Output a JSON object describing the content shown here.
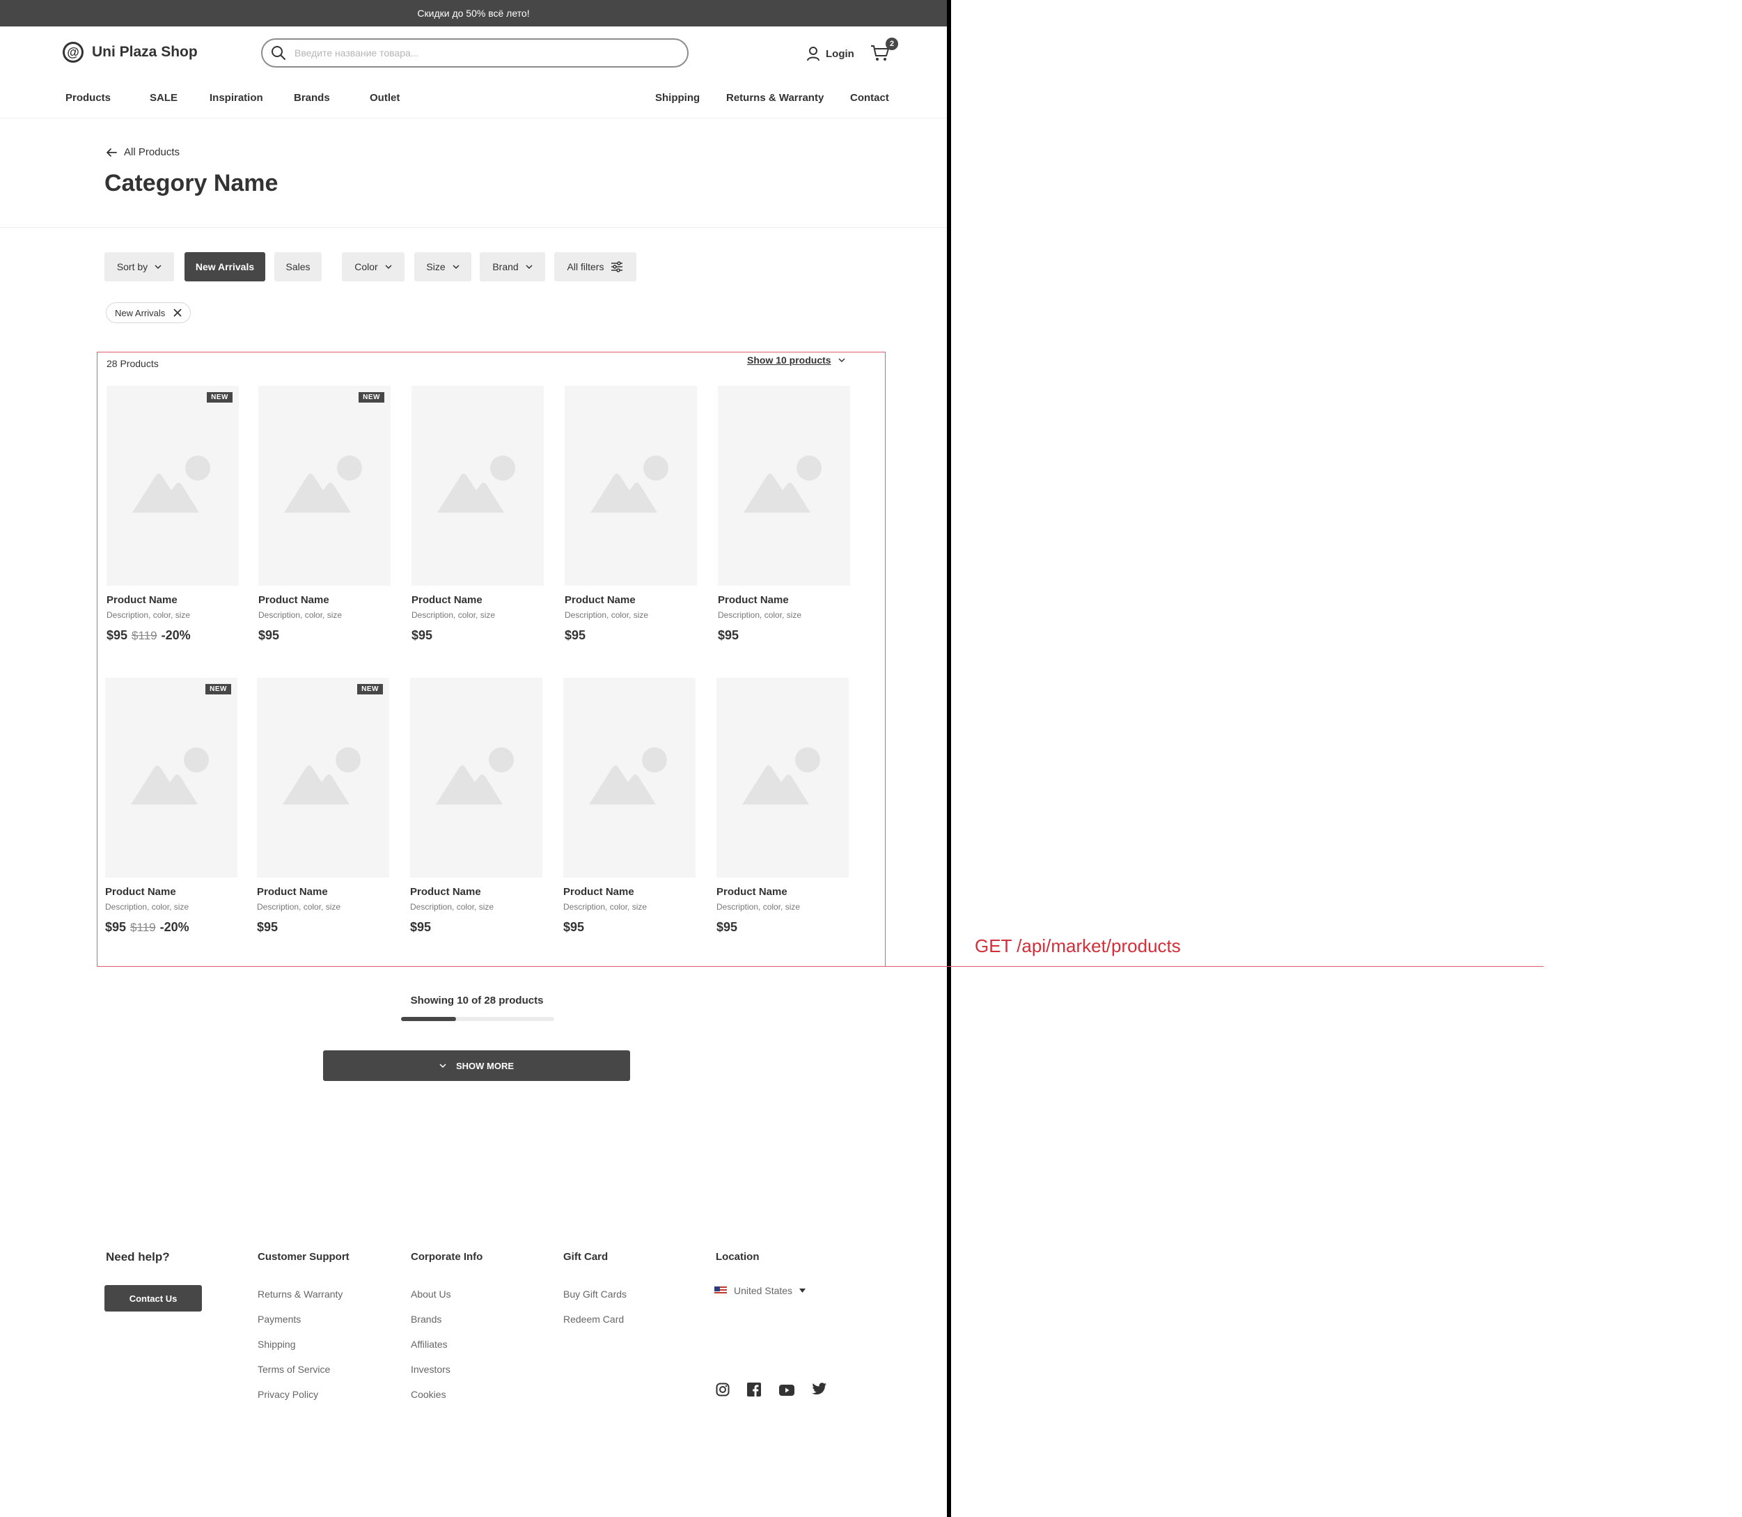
{
  "promo": "Скидки до 50% всё лето!",
  "header": {
    "logo": "Uni Plaza Shop",
    "search_placeholder": "Введите название товара...",
    "login": "Login",
    "cart_count": "2"
  },
  "nav_left": [
    "Products",
    "SALE",
    "Inspiration",
    "Brands",
    "Outlet"
  ],
  "nav_right": [
    "Shipping",
    "Returns & Warranty",
    "Contact"
  ],
  "breadcrumb": "All Products",
  "page_title": "Category Name",
  "filters": {
    "sort_by": "Sort by",
    "new_arrivals": "New Arrivals",
    "sales": "Sales",
    "color": "Color",
    "size": "Size",
    "brand": "Brand",
    "all_filters": "All filters"
  },
  "active_tag": "New Arrivals",
  "results": {
    "count": "28 Products",
    "show_label": "Show 10 products"
  },
  "products": [
    {
      "name": "Product Name",
      "desc": "Description, color, size",
      "price": "$95",
      "old_price": "$119",
      "discount": "-20%",
      "badge": "NEW"
    },
    {
      "name": "Product Name",
      "desc": "Description, color, size",
      "price": "$95",
      "old_price": "",
      "discount": "",
      "badge": "NEW"
    },
    {
      "name": "Product Name",
      "desc": "Description, color, size",
      "price": "$95",
      "old_price": "",
      "discount": "",
      "badge": ""
    },
    {
      "name": "Product Name",
      "desc": "Description, color, size",
      "price": "$95",
      "old_price": "",
      "discount": "",
      "badge": ""
    },
    {
      "name": "Product Name",
      "desc": "Description, color, size",
      "price": "$95",
      "old_price": "",
      "discount": "",
      "badge": ""
    },
    {
      "name": "Product Name",
      "desc": "Description, color, size",
      "price": "$95",
      "old_price": "$119",
      "discount": "-20%",
      "badge": "NEW"
    },
    {
      "name": "Product Name",
      "desc": "Description, color, size",
      "price": "$95",
      "old_price": "",
      "discount": "",
      "badge": "NEW"
    },
    {
      "name": "Product Name",
      "desc": "Description, color, size",
      "price": "$95",
      "old_price": "",
      "discount": "",
      "badge": ""
    },
    {
      "name": "Product Name",
      "desc": "Description, color, size",
      "price": "$95",
      "old_price": "",
      "discount": "",
      "badge": ""
    },
    {
      "name": "Product Name",
      "desc": "Description, color, size",
      "price": "$95",
      "old_price": "",
      "discount": "",
      "badge": ""
    }
  ],
  "pagination": {
    "showing": "Showing 10 of 28 products",
    "progress": 0.357,
    "show_more": "SHOW MORE"
  },
  "annotation": "GET /api/market/products",
  "footer": {
    "need_help": "Need help?",
    "contact_us": "Contact Us",
    "columns": [
      {
        "title": "Customer Support",
        "links": [
          "Returns & Warranty",
          "Payments",
          "Shipping",
          "Terms of Service",
          "Privacy Policy"
        ]
      },
      {
        "title": "Corporate Info",
        "links": [
          "About Us",
          "Brands",
          "Affiliates",
          "Investors",
          "Cookies"
        ]
      },
      {
        "title": "Gift Card",
        "links": [
          "Buy Gift Cards",
          "Redeem Card"
        ]
      }
    ],
    "location_title": "Location",
    "location": "United States",
    "social": [
      "instagram-icon",
      "facebook-icon",
      "youtube-icon",
      "twitter-icon"
    ]
  }
}
